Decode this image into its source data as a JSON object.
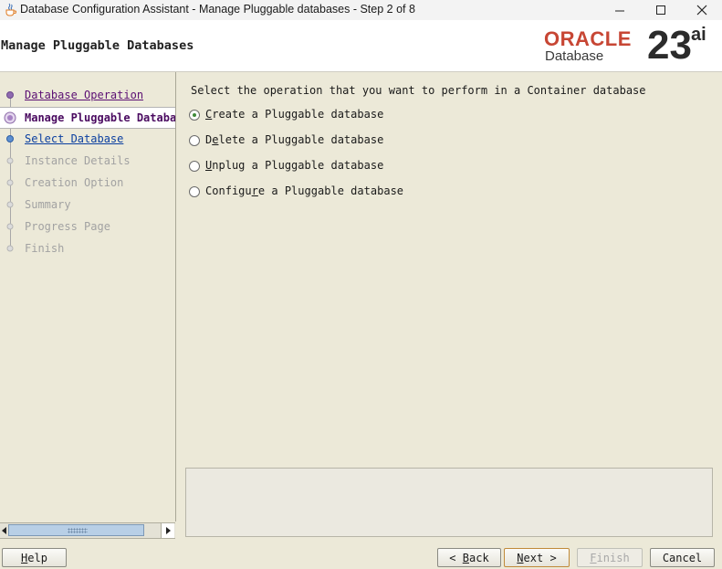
{
  "window": {
    "title": "Database Configuration Assistant - Manage Pluggable databases - Step 2 of 8"
  },
  "header": {
    "heading": "Manage Pluggable Databases",
    "brand": {
      "oracle": "ORACLE",
      "product": "Database",
      "version": "23",
      "version_suffix": "ai"
    }
  },
  "nav": {
    "items": [
      {
        "label": "Database Operation",
        "state": "done"
      },
      {
        "label": "Manage Pluggable Databases",
        "state": "current"
      },
      {
        "label": "Select Database",
        "state": "next"
      },
      {
        "label": "Instance Details",
        "state": "pending"
      },
      {
        "label": "Creation Option",
        "state": "pending"
      },
      {
        "label": "Summary",
        "state": "pending"
      },
      {
        "label": "Progress Page",
        "state": "pending"
      },
      {
        "label": "Finish",
        "state": "pending"
      }
    ]
  },
  "content": {
    "instruction": "Select the operation that you want to perform in a Container database",
    "options": [
      {
        "label": "Create a Pluggable database",
        "mnemonic_index": 0,
        "selected": true
      },
      {
        "label": "Delete a Pluggable database",
        "mnemonic_index": 1,
        "selected": false
      },
      {
        "label": "Unplug a Pluggable database",
        "mnemonic_index": 0,
        "selected": false
      },
      {
        "label": "Configure a Pluggable database",
        "mnemonic_index": 7,
        "selected": false
      }
    ]
  },
  "buttons": {
    "help": "Help",
    "back": "< Back",
    "next": "Next >",
    "finish": "Finish",
    "cancel": "Cancel"
  },
  "colors": {
    "oracle_red": "#c74634",
    "done_step": "#5b0f73",
    "next_step": "#0b3fa0",
    "pending_step": "#a2a2a2",
    "panel_bg": "#ece9d8"
  }
}
